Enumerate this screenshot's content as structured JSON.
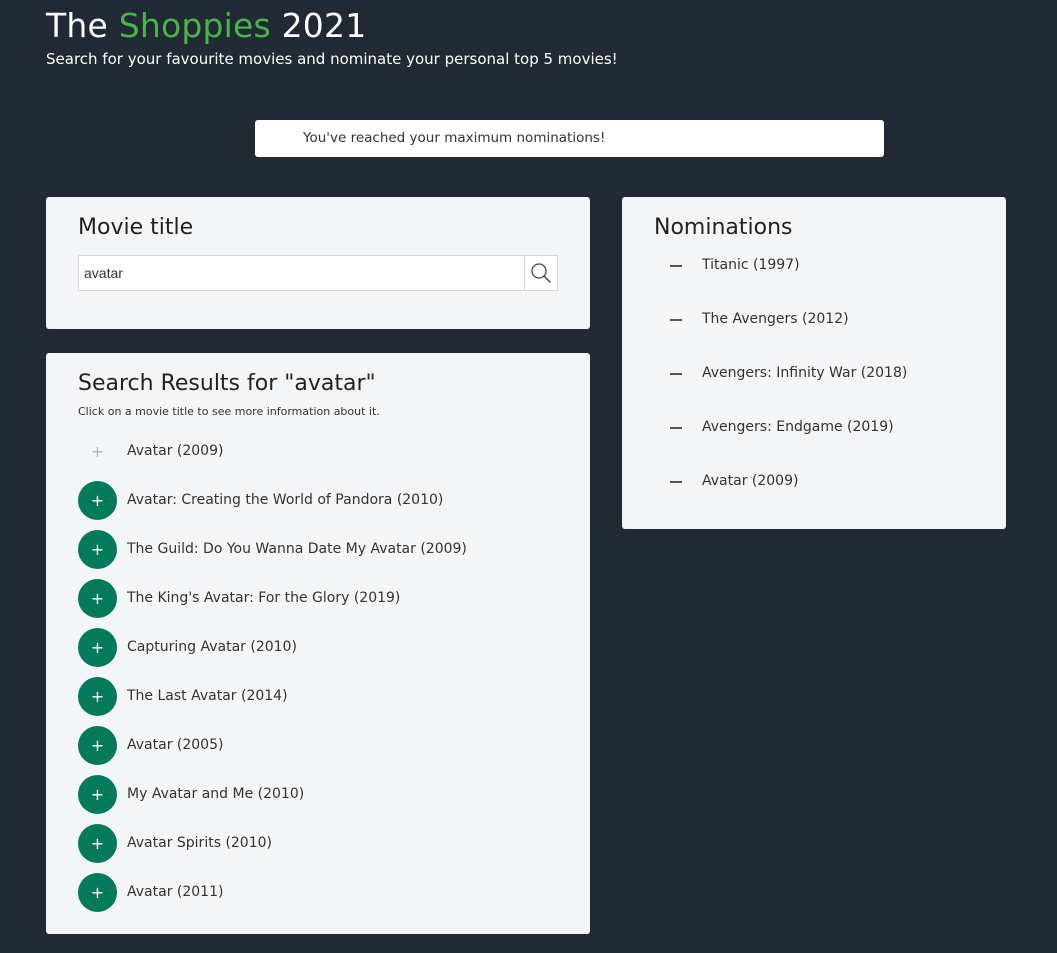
{
  "header": {
    "title_prefix": "The",
    "title_accent": "Shoppies",
    "title_suffix": "2021",
    "subtitle": "Search for your favourite movies and nominate your personal top 5 movies!",
    "accent_color": "#4ab448"
  },
  "banner": {
    "message": "You've reached your maximum nominations!"
  },
  "search": {
    "heading": "Movie title",
    "value": "avatar",
    "icon": "search-icon"
  },
  "results": {
    "heading_prefix": "Search Results for \"",
    "query": "avatar",
    "heading_suffix": "\"",
    "hint": "Click on a movie title to see more information about it.",
    "add_symbol": "+",
    "button_color": "#047a5c",
    "items": [
      {
        "title": "Avatar (2009)",
        "nominated": true
      },
      {
        "title": "Avatar: Creating the World of Pandora (2010)",
        "nominated": false
      },
      {
        "title": "The Guild: Do You Wanna Date My Avatar (2009)",
        "nominated": false
      },
      {
        "title": "The King's Avatar: For the Glory (2019)",
        "nominated": false
      },
      {
        "title": "Capturing Avatar (2010)",
        "nominated": false
      },
      {
        "title": "The Last Avatar (2014)",
        "nominated": false
      },
      {
        "title": "Avatar (2005)",
        "nominated": false
      },
      {
        "title": "My Avatar and Me (2010)",
        "nominated": false
      },
      {
        "title": "Avatar Spirits (2010)",
        "nominated": false
      },
      {
        "title": "Avatar (2011)",
        "nominated": false
      }
    ]
  },
  "nominations": {
    "heading": "Nominations",
    "remove_icon": "minus-icon",
    "items": [
      {
        "title": "Titanic (1997)"
      },
      {
        "title": "The Avengers (2012)"
      },
      {
        "title": "Avengers: Infinity War (2018)"
      },
      {
        "title": "Avengers: Endgame (2019)"
      },
      {
        "title": "Avatar (2009)"
      }
    ]
  }
}
